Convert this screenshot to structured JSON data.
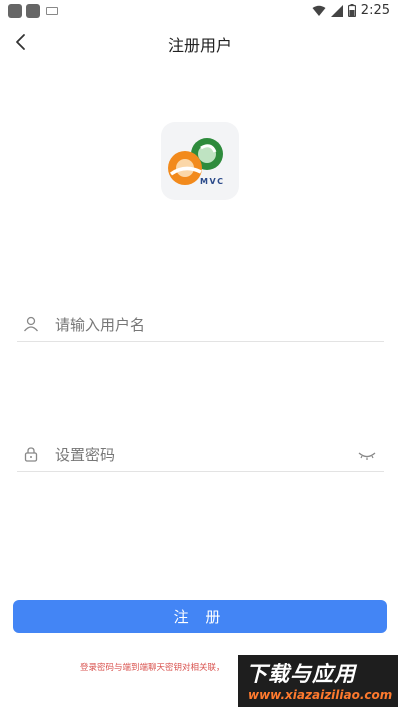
{
  "status_bar": {
    "time": "2:25"
  },
  "header": {
    "title": "注册用户"
  },
  "logo": {
    "text": "MVC",
    "colors": {
      "green": "#2e8b3c",
      "orange": "#f28a1c"
    }
  },
  "form": {
    "username": {
      "placeholder": "请输入用户名",
      "value": ""
    },
    "password": {
      "placeholder": "设置密码",
      "value": ""
    },
    "register_label": "注 册"
  },
  "notice": "登录密码与端到端聊天密钥对相关联，",
  "watermark": {
    "title": "下载与应用",
    "url": "www.xiazaiziliao.com"
  },
  "colors": {
    "primary": "#4385f5",
    "notice_red": "#d9534f"
  }
}
